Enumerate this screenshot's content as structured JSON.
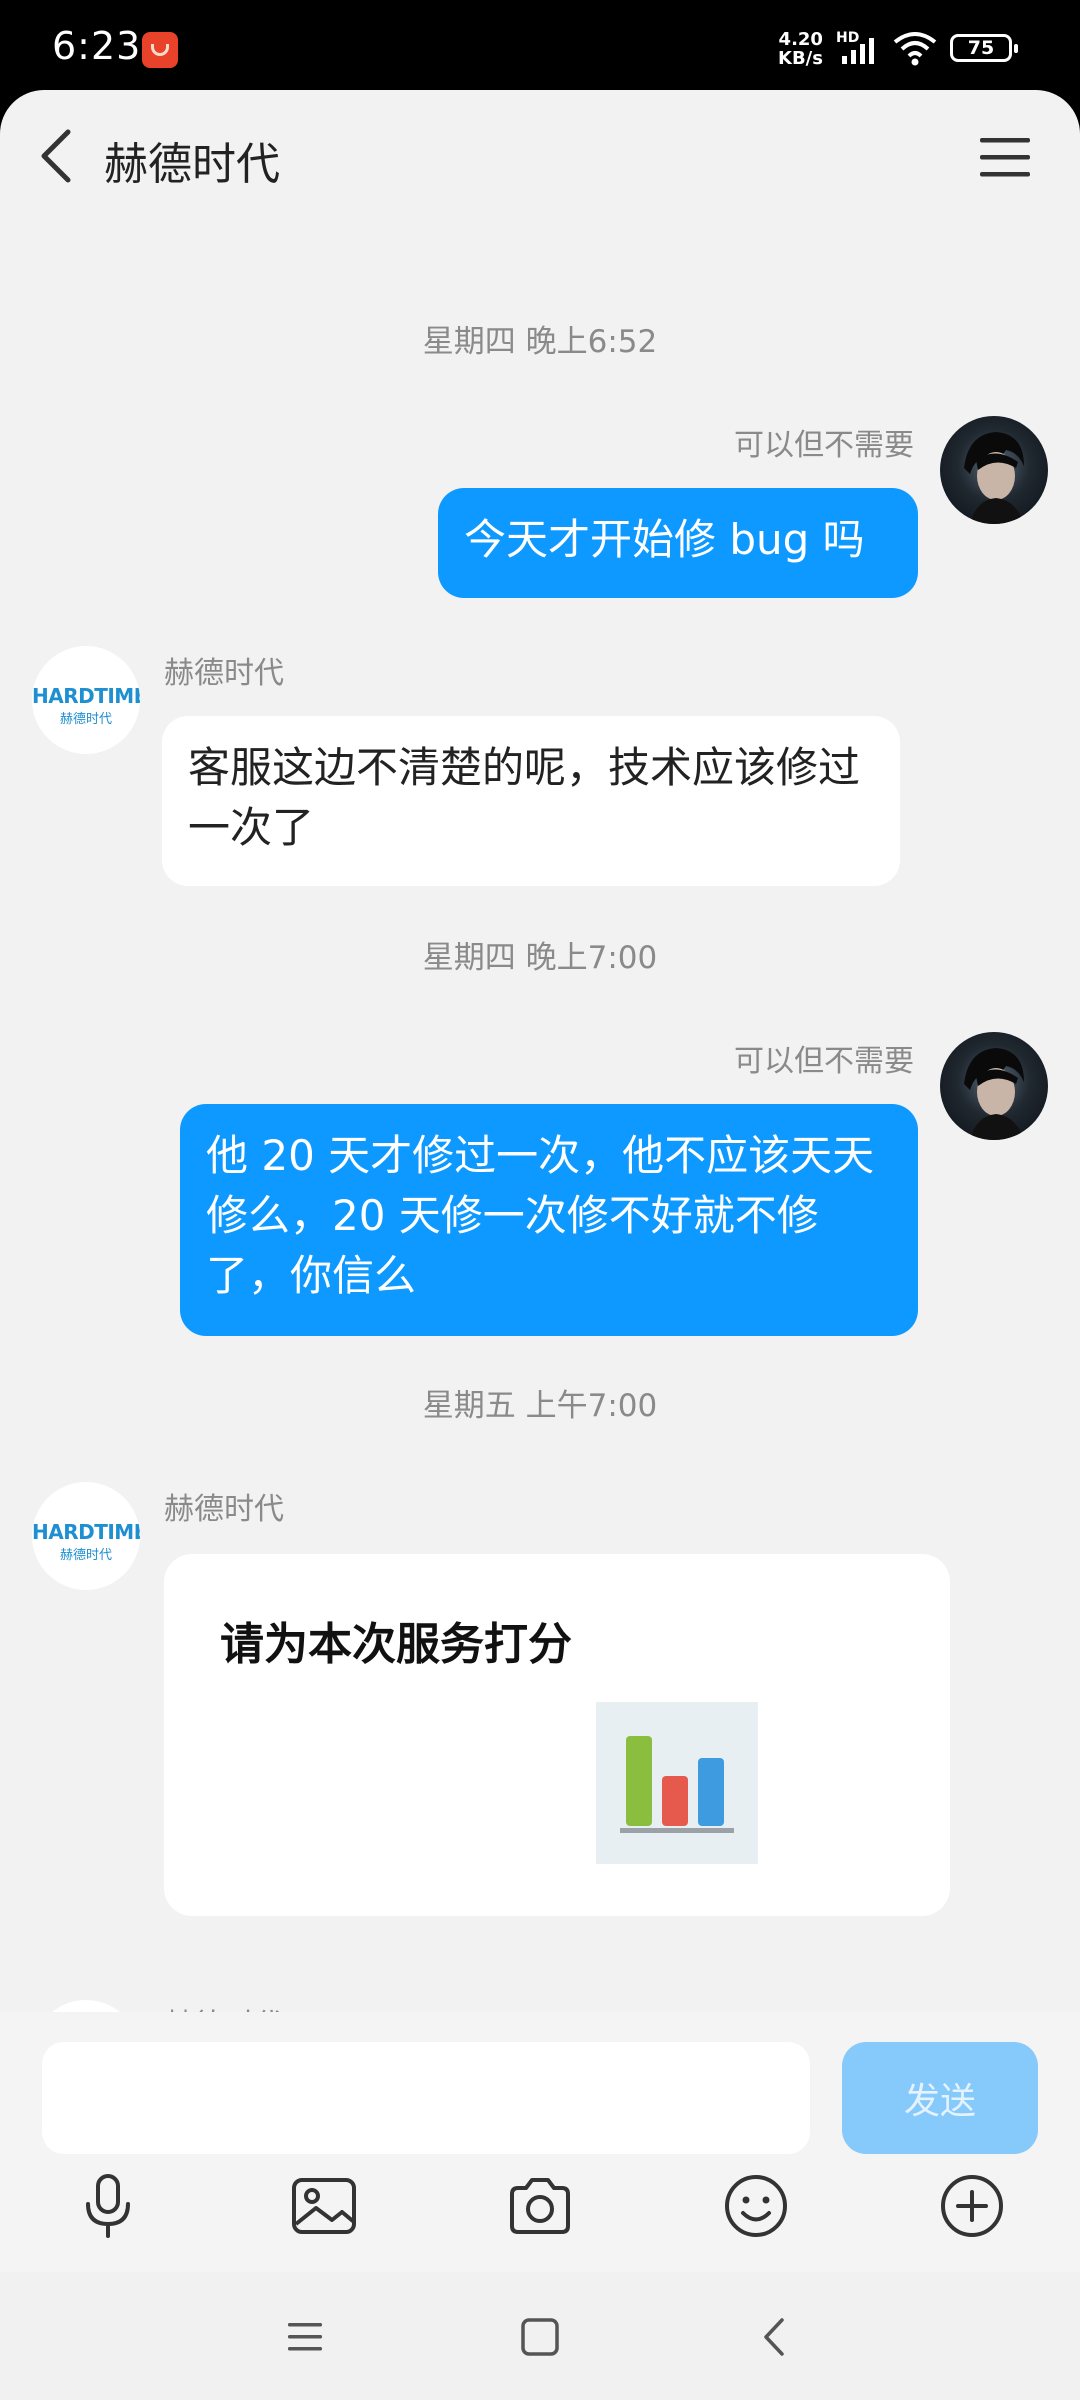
{
  "status_bar": {
    "time": "6:23",
    "net_speed_value": "4.20",
    "net_speed_unit": "KB/s",
    "hd_label": "HD",
    "battery": "75"
  },
  "header": {
    "title": "赫德时代",
    "back_icon": "chevron-left-icon",
    "menu_icon": "hamburger-menu-icon"
  },
  "brand_logo": {
    "text": "HARDTIME",
    "sub": "赫德时代"
  },
  "messages": [
    {
      "type": "timestamp",
      "text": "星期四 晚上6:52"
    },
    {
      "type": "outgoing",
      "sender": "可以但不需要",
      "text": "今天才开始修 bug 吗"
    },
    {
      "type": "incoming",
      "sender": "赫德时代",
      "text": "客服这边不清楚的呢，技术应该修过一次了"
    },
    {
      "type": "timestamp",
      "text": "星期四 晚上7:00"
    },
    {
      "type": "outgoing",
      "sender": "可以但不需要",
      "text": "他 20 天才修过一次，他不应该天天修么，20 天修一次修不好就不修了，你信么"
    },
    {
      "type": "timestamp",
      "text": "星期五 上午7:00"
    },
    {
      "type": "incoming",
      "sender": "赫德时代",
      "card_title": "请为本次服务打分"
    },
    {
      "type": "incoming_partial",
      "sender": "赫德时代"
    }
  ],
  "input": {
    "value": "",
    "placeholder": "",
    "send_label": "发送"
  },
  "toolbar": [
    "microphone-icon",
    "image-icon",
    "camera-icon",
    "emoji-icon",
    "plus-circle-icon"
  ],
  "nav": [
    "recent-apps-icon",
    "home-icon",
    "back-icon"
  ],
  "colors": {
    "accent": "#0D99FF",
    "send_disabled": "#86C9FB",
    "background": "#F2F2F2"
  }
}
